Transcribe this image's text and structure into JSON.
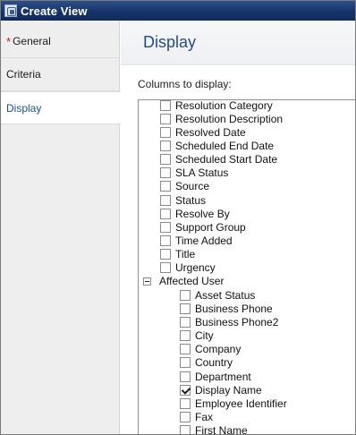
{
  "window": {
    "title": "Create View"
  },
  "nav": {
    "required_marker": "*",
    "items": [
      {
        "label": "General",
        "required": true
      },
      {
        "label": "Criteria",
        "required": false
      },
      {
        "label": "Display",
        "required": false,
        "selected": true
      }
    ]
  },
  "main": {
    "title": "Display",
    "columns_label": "Columns to display:"
  },
  "tree": {
    "top_items": [
      {
        "label": "Resolution Category",
        "checked": false
      },
      {
        "label": "Resolution Description",
        "checked": false
      },
      {
        "label": "Resolved Date",
        "checked": false
      },
      {
        "label": "Scheduled End Date",
        "checked": false
      },
      {
        "label": "Scheduled Start Date",
        "checked": false
      },
      {
        "label": "SLA Status",
        "checked": false
      },
      {
        "label": "Source",
        "checked": false
      },
      {
        "label": "Status",
        "checked": false
      },
      {
        "label": "Resolve By",
        "checked": false
      },
      {
        "label": "Support Group",
        "checked": false
      },
      {
        "label": "Time Added",
        "checked": false
      },
      {
        "label": "Title",
        "checked": false
      },
      {
        "label": "Urgency",
        "checked": false
      }
    ],
    "group": {
      "label": "Affected User",
      "expanded": true,
      "children": [
        {
          "label": "Asset Status",
          "checked": false
        },
        {
          "label": "Business Phone",
          "checked": false
        },
        {
          "label": "Business Phone2",
          "checked": false
        },
        {
          "label": "City",
          "checked": false
        },
        {
          "label": "Company",
          "checked": false
        },
        {
          "label": "Country",
          "checked": false
        },
        {
          "label": "Department",
          "checked": false
        },
        {
          "label": "Display Name",
          "checked": true
        },
        {
          "label": "Employee Identifier",
          "checked": false
        },
        {
          "label": "Fax",
          "checked": false
        },
        {
          "label": "First Name",
          "checked": false
        }
      ]
    }
  }
}
